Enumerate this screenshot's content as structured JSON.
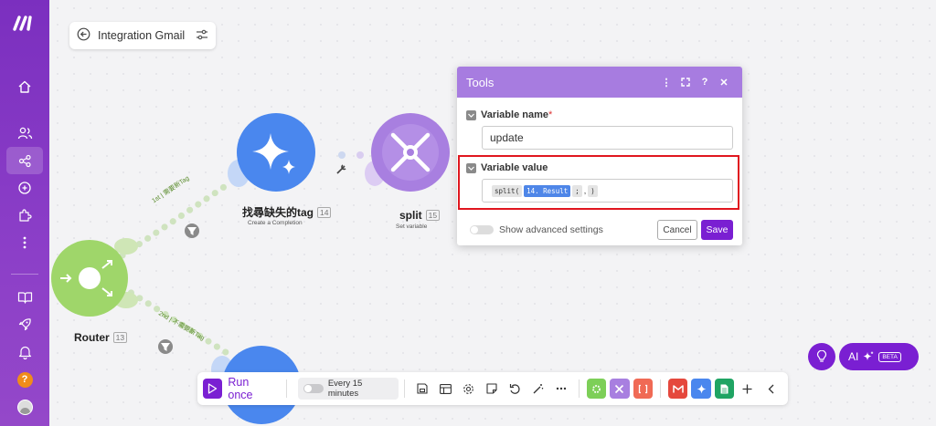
{
  "scenario": {
    "name": "Integration Gmail"
  },
  "nodes": {
    "router": {
      "label": "Router",
      "id": "13"
    },
    "ai": {
      "label": "找尋缺失的tag",
      "id": "14",
      "sub": "Create a Completion"
    },
    "split": {
      "label": "split",
      "id": "15",
      "sub": "Set variable"
    }
  },
  "routes": {
    "first": "1st | 需要新Tag",
    "second": "2nd | 不需要新Tag"
  },
  "panel": {
    "title": "Tools",
    "var_name_label": "Variable name",
    "var_name_required": "*",
    "var_name_value": "update",
    "var_value_label": "Variable value",
    "tokens": {
      "fn": "split(",
      "var": "14. Result",
      "arg": ";",
      "comma": ",",
      "close": ")"
    },
    "advanced_label": "Show advanced settings",
    "cancel": "Cancel",
    "save": "Save"
  },
  "toolbar": {
    "run_label": "Run once",
    "schedule_label": "Every 15 minutes"
  },
  "ai_button": {
    "label": "AI",
    "badge": "BETA"
  },
  "sidebar_help": "?",
  "colors": {
    "brand": "#7a1fd2",
    "panel_header": "#a77ce0",
    "router": "#9fd66a",
    "ai_node": "#4a87ee",
    "tools_node": "#a87fe0",
    "highlight": "#e0161f"
  }
}
